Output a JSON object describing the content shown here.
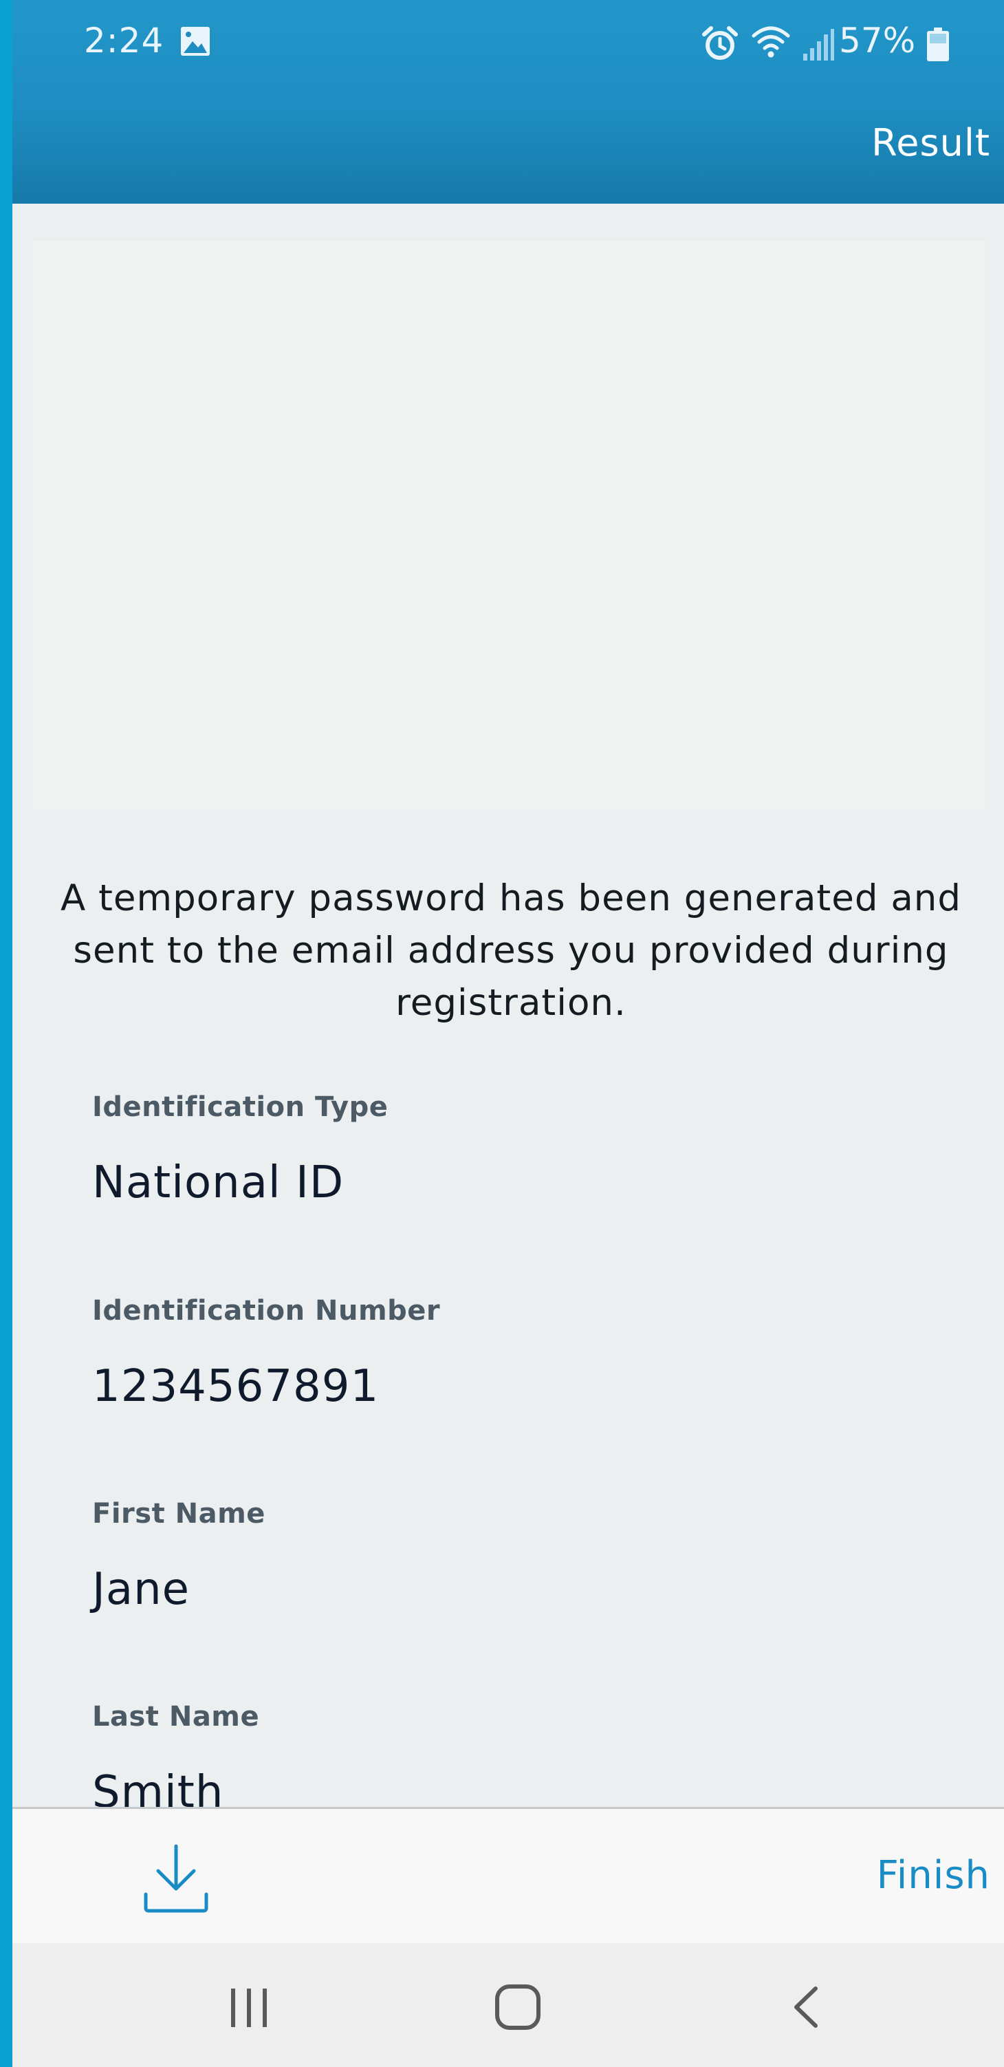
{
  "status_bar": {
    "time": "2:24",
    "battery_percent": "57%",
    "icons": [
      "gallery-icon",
      "alarm-icon",
      "wifi-icon",
      "signal-icon",
      "battery-icon"
    ]
  },
  "header": {
    "title": "Result"
  },
  "message": "A temporary password has been generated and sent to the email address you provided during registration.",
  "fields": [
    {
      "label": "Identification Type",
      "value": "National ID"
    },
    {
      "label": "Identification Number",
      "value": "1234567891"
    },
    {
      "label": "First Name",
      "value": "Jane"
    },
    {
      "label": "Last Name",
      "value": "Smith"
    }
  ],
  "bottom_bar": {
    "download_icon": "download-icon",
    "finish_label": "Finish"
  },
  "nav_bar": {
    "icons": [
      "recents-icon",
      "home-icon",
      "back-icon"
    ]
  },
  "colors": {
    "header": "#1e8dc1",
    "accent": "#1a8cc5",
    "background": "#eceff0"
  }
}
